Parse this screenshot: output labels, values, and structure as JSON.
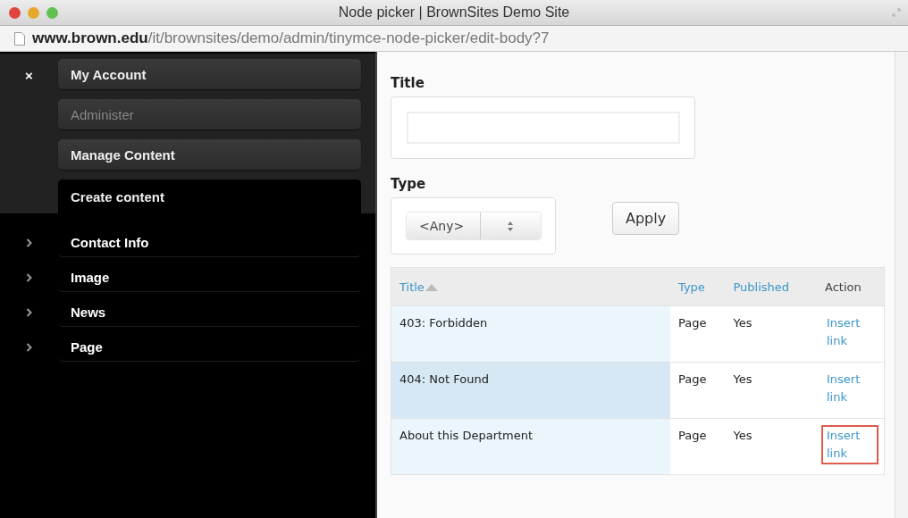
{
  "window": {
    "title": "Node picker | BrownSites Demo Site"
  },
  "address_bar": {
    "host": "www.brown.edu",
    "path": "/it/brownsites/demo/admin/tinymce-node-picker/edit-body?7"
  },
  "sidebar": {
    "close_label": "×",
    "menu": [
      {
        "label": "My Account",
        "disabled": false,
        "selected": false
      },
      {
        "label": "Administer",
        "disabled": true,
        "selected": false
      },
      {
        "label": "Manage Content",
        "disabled": false,
        "selected": false
      },
      {
        "label": "Create content",
        "disabled": false,
        "selected": true
      }
    ],
    "submenu": [
      {
        "label": "Contact Info",
        "expanded": false
      },
      {
        "label": "Image",
        "expanded": false
      },
      {
        "label": "News",
        "expanded": false
      },
      {
        "label": "Page",
        "expanded": false
      }
    ]
  },
  "filters": {
    "title_label": "Title",
    "type_label": "Type",
    "type_value": "<Any>",
    "apply_button": "Apply"
  },
  "table": {
    "columns": [
      {
        "label": "Title",
        "kind": "link",
        "sorted": true
      },
      {
        "label": "Type",
        "kind": "link",
        "sorted": false
      },
      {
        "label": "Published",
        "kind": "link",
        "sorted": false
      },
      {
        "label": "Action",
        "kind": "text",
        "sorted": false
      }
    ],
    "rows": [
      {
        "title": "403: Forbidden",
        "type": "Page",
        "published": "Yes",
        "action": "Insert link",
        "hovered": false,
        "highlighted": false
      },
      {
        "title": "404: Not Found",
        "type": "Page",
        "published": "Yes",
        "action": "Insert link",
        "hovered": true,
        "highlighted": false
      },
      {
        "title": "About this Department",
        "type": "Page",
        "published": "Yes",
        "action": "Insert link",
        "hovered": false,
        "highlighted": true
      }
    ]
  }
}
